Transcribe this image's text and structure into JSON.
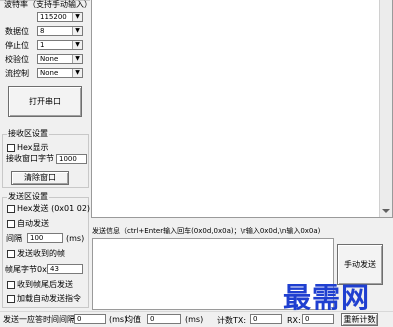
{
  "serial": {
    "baud_label": "波特率（支持手动输入）",
    "baud_value": "115200",
    "databits_label": "数据位",
    "databits_value": "8",
    "stopbits_label": "停止位",
    "stopbits_value": "1",
    "parity_label": "校验位",
    "parity_value": "None",
    "flow_label": "流控制",
    "flow_value": "None",
    "open_button": "打开串口"
  },
  "receive": {
    "group_title": "接收区设置",
    "hex_display": "Hex显示",
    "window_bytes_label": "接收窗口字节",
    "window_bytes_value": "1000",
    "clear_button": "清除窗口"
  },
  "send": {
    "group_title": "发送区设置",
    "hex_send": "Hex发送 (0x01 02)",
    "auto_send": "自动发送",
    "period_label": "间隔",
    "period_value": "100",
    "period_unit": "(ms)",
    "send_received": "发送收到的帧",
    "frame_tail_label": "帧尾字节0x:",
    "frame_tail_value": "43",
    "send_after_receive": "收到帧尾后发送",
    "add_auto_cmd": "加载自动发送指令"
  },
  "send_info": {
    "label": "发送信息（ctrl+Enter输入回车(0x0d,0x0a)；\\r输入0x0d,\\n输入0x0a)",
    "send_button": "手动发送"
  },
  "status": {
    "delay_label": "发送一应答时间间隔",
    "delay_value": "0",
    "delay_unit": "(ms)",
    "avg_label": "均值",
    "avg_value": "0",
    "avg_unit": "(ms)",
    "count_tx_label": "计数TX:",
    "count_tx_value": "0",
    "rx_label": "RX:",
    "rx_value": "0",
    "reset_button": "重新计数"
  },
  "watermark": "最需网",
  "colors": {
    "background": "#f0f0f0",
    "watermark": "#1f3fd0"
  }
}
